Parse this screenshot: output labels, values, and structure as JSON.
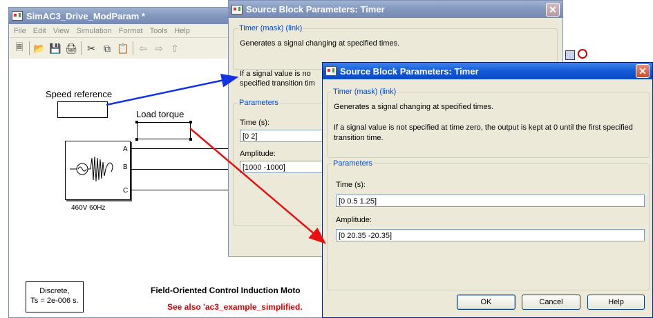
{
  "model_window": {
    "title": "SimAC3_Drive_ModParam *",
    "menu": [
      "File",
      "Edit",
      "View",
      "Simulation",
      "Format",
      "Tools",
      "Help"
    ],
    "toolbar_icons": [
      "new-icon",
      "open-icon",
      "save-icon",
      "print-icon",
      "cut-icon",
      "copy-icon",
      "paste-icon",
      "back-icon",
      "forward-icon",
      "up-icon"
    ]
  },
  "diagram": {
    "speed_reference_label": "Speed reference",
    "load_torque_label": "Load torque",
    "source_ports": [
      "A",
      "B",
      "C"
    ],
    "source_label": "460V 60Hz",
    "discrete_line1": "Discrete,",
    "discrete_line2": "Ts = 2e-006 s.",
    "title": "Field-Oriented Control Induction Moto",
    "see_also": "See also 'ac3_example_simplified."
  },
  "dialog_back": {
    "title": "Source Block Parameters: Timer",
    "group_title": "Timer (mask) (link)",
    "description_1": "Generates a signal changing at specified times.",
    "description_2a": "If a signal value is no",
    "description_2b": "specified transition tim",
    "parameters_title": "Parameters",
    "time_label": "Time (s):",
    "time_value": "[0 2]",
    "amplitude_label": "Amplitude:",
    "amplitude_value": "[1000 -1000]"
  },
  "dialog_front": {
    "title": "Source Block Parameters: Timer",
    "group_title": "Timer (mask) (link)",
    "description_1": "Generates a signal changing at specified times.",
    "description_2": "If a signal value is not specified at time zero, the output is kept at 0 until the first specified transition time.",
    "parameters_title": "Parameters",
    "time_label": "Time (s):",
    "time_value": "[0 0.5 1.25]",
    "amplitude_label": "Amplitude:",
    "amplitude_value": "[0 20.35 -20.35]",
    "ok_label": "OK",
    "cancel_label": "Cancel",
    "help_label": "Help"
  },
  "colors": {
    "blue_arrow": "#1433e0",
    "red_arrow": "#e81010",
    "titlebar_active": "#0b55d8",
    "dialog_face": "#ece9d8",
    "see_also_text": "#dd0000"
  }
}
